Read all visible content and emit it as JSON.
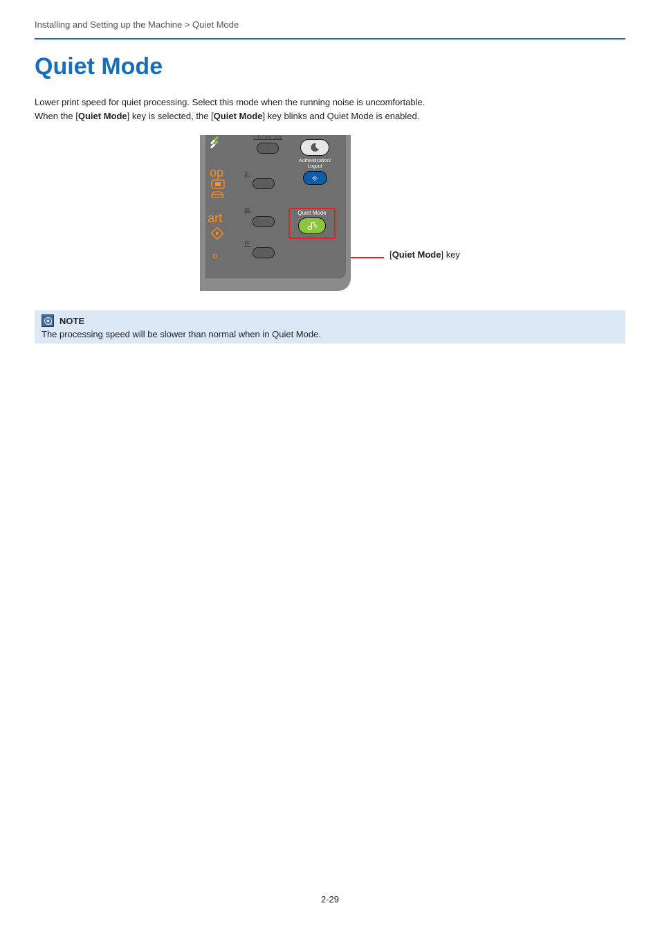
{
  "breadcrumb": "Installing and Setting up the Machine > Quiet Mode",
  "title": "Quiet Mode",
  "paragraph1": "Lower print speed for quiet processing. Select this mode when the running noise is uncomfortable.",
  "paragraph2_pre": "When the [",
  "paragraph2_bold1": "Quiet Mode",
  "paragraph2_mid": "] key is selected, the [",
  "paragraph2_bold2": "Quiet Mode",
  "paragraph2_post": "] key blinks and Quiet Mode is enabled.",
  "panel": {
    "top_label": "I. ID Card Copy",
    "left_op": "op",
    "left_art": "art",
    "left_o": "o",
    "roman2": "II.",
    "roman3": "III.",
    "roman4": "IV.",
    "auth_line1": "Authentication/",
    "auth_line2": "Logout",
    "quiet_label": "Quiet Mode"
  },
  "callout_pre": "[",
  "callout_bold": "Quiet Mode",
  "callout_post": "] key",
  "note": {
    "title": "NOTE",
    "body": "The processing speed will be slower than normal when in Quiet Mode."
  },
  "page_number": "2-29"
}
